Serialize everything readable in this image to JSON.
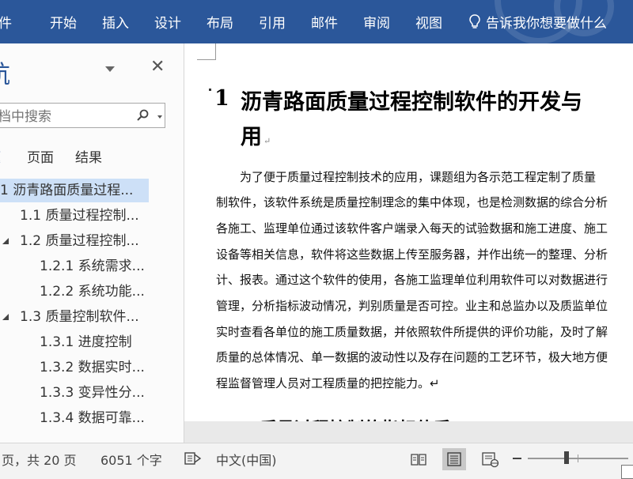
{
  "ribbon": {
    "tabs": [
      "件",
      "开始",
      "插入",
      "设计",
      "布局",
      "引用",
      "邮件",
      "审阅",
      "视图"
    ],
    "tell_me": "告诉我你想要做什么",
    "tell_me_icon": "lightbulb-icon",
    "background": "#2b579a"
  },
  "nav": {
    "title": "航",
    "close_icon": "close-icon",
    "search": {
      "placeholder": "文档中搜索",
      "icon": "search-icon"
    },
    "tabs": [
      "题",
      "页面",
      "结果"
    ],
    "headings": [
      {
        "label": "1 沥青路面质量过程...",
        "level": 1,
        "selected": true,
        "expandable": false
      },
      {
        "label": "1.1 质量过程控制...",
        "level": 2,
        "selected": false,
        "expandable": false
      },
      {
        "label": "1.2 质量过程控制...",
        "level": 2,
        "selected": false,
        "expandable": true
      },
      {
        "label": "1.2.1 系统需求...",
        "level": 3,
        "selected": false,
        "expandable": false
      },
      {
        "label": "1.2.2 系统功能...",
        "level": 3,
        "selected": false,
        "expandable": false
      },
      {
        "label": "1.3 质量控制软件...",
        "level": 2,
        "selected": false,
        "expandable": true
      },
      {
        "label": "1.3.1 进度控制",
        "level": 3,
        "selected": false,
        "expandable": false
      },
      {
        "label": "1.3.2 数据实时...",
        "level": 3,
        "selected": false,
        "expandable": false
      },
      {
        "label": "1.3.3 变异性分...",
        "level": 3,
        "selected": false,
        "expandable": false
      },
      {
        "label": "1.3.4 数据可靠...",
        "level": 3,
        "selected": false,
        "expandable": false
      }
    ]
  },
  "document": {
    "heading_number": "1",
    "heading_line1": "沥青路面质量过程控制软件的开发与",
    "heading_line2": "用",
    "paragraph_mark": "↵",
    "paragraph_lines": [
      "　　为了便于质量过程控制技术的应用，课题组为各示范工程定制了质量",
      "制软件，该软件系统是质量控制理念的集中体现，也是检测数据的综合分析",
      "各施工、监理单位通过该软件客户端录入每天的试验数据和施工进度、施工",
      "设备等相关信息，软件将这些数据上传至服务器，并作出统一的整理、分析",
      "计、报表。通过这个软件的使用，各施工监理单位利用软件可以对数据进行",
      "管理，分析指标波动情况，判别质量是否可控。业主和总监办以及质监单位",
      "实时查看各单位的施工质量数据，并依照软件所提供的评价功能，及时了解",
      "质量的总体情况、单一数据的波动性以及存在问题的工艺环节，极大地方便",
      "程监督管理人员对工程质量的把控能力。↵"
    ],
    "next_heading_partial": "质量过程控制的指标体系"
  },
  "status": {
    "page": "页，共 20 页",
    "words": "6051 个字",
    "language": "中文(中国)",
    "proof_icon": "proofing-icon",
    "view_icons": [
      "read-mode-icon",
      "print-layout-icon",
      "web-layout-icon"
    ],
    "zoom_icon": "zoom-minus-icon"
  }
}
